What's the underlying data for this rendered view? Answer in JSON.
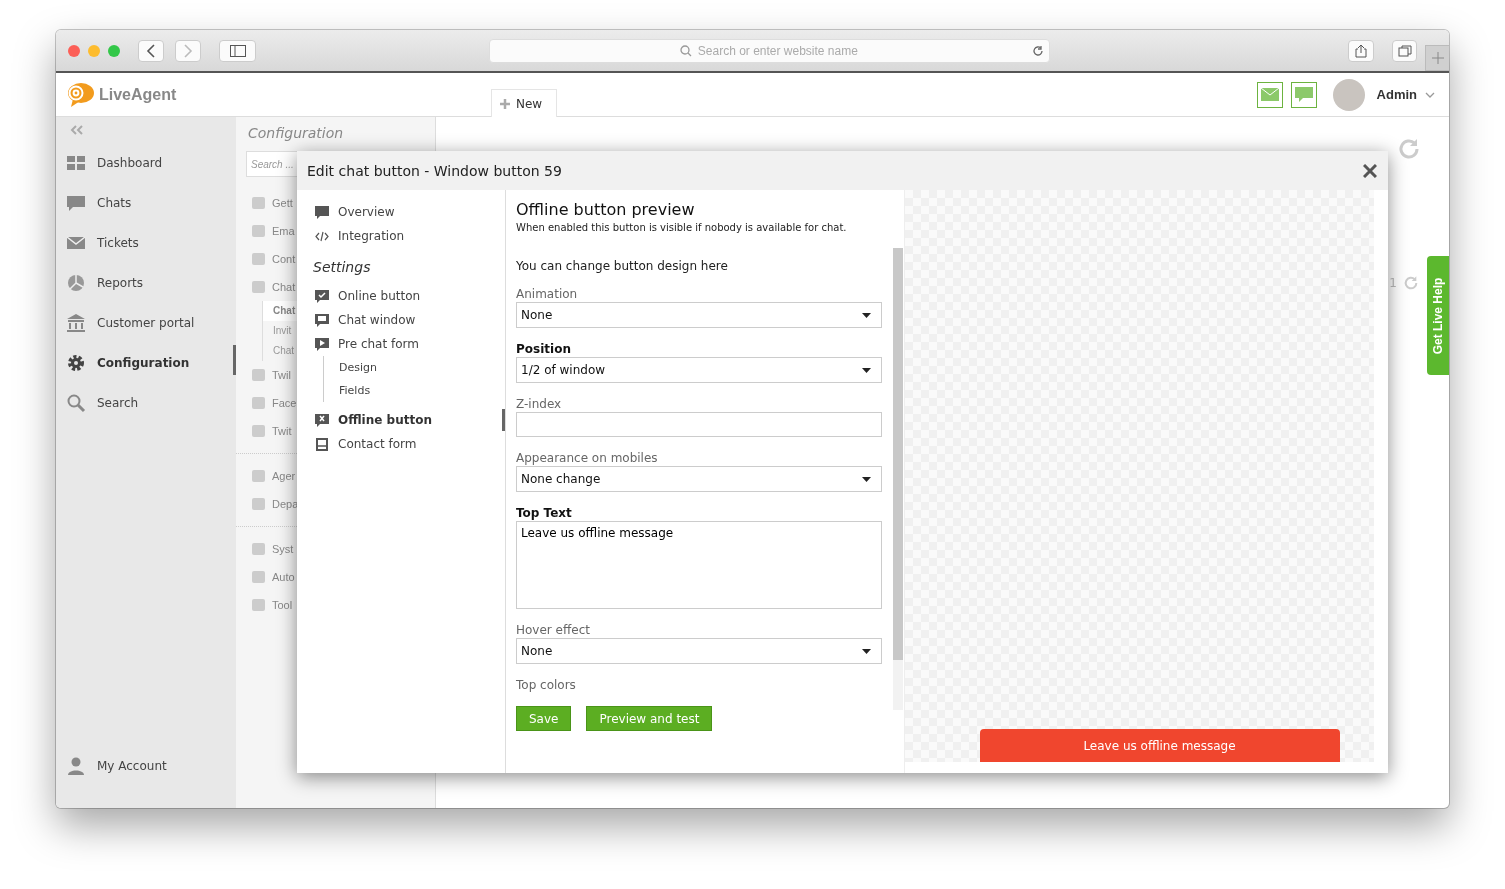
{
  "browser": {
    "address_placeholder": "Search or enter website name"
  },
  "header": {
    "logo": "LiveAgent",
    "new_button": "New",
    "user_name": "Admin"
  },
  "sidebar": {
    "items": [
      {
        "label": "Dashboard",
        "selected": false
      },
      {
        "label": "Chats",
        "selected": false
      },
      {
        "label": "Tickets",
        "selected": false
      },
      {
        "label": "Reports",
        "selected": false
      },
      {
        "label": "Customer portal",
        "selected": false
      },
      {
        "label": "Configuration",
        "selected": true
      },
      {
        "label": "Search",
        "selected": false
      }
    ],
    "account": "My Account"
  },
  "config_panel": {
    "title": "Configuration",
    "search_placeholder": "Search ...",
    "groups": [
      [
        {
          "label": "Gett",
          "kind": "item"
        },
        {
          "label": "Ema",
          "kind": "item"
        },
        {
          "label": "Cont",
          "kind": "item"
        },
        {
          "label": "Chat",
          "kind": "item"
        },
        {
          "label": "Chat",
          "kind": "sub",
          "selected": true
        },
        {
          "label": "Invit",
          "kind": "sub",
          "selected": false
        },
        {
          "label": "Chat",
          "kind": "sub",
          "selected": false
        },
        {
          "label": "Twil",
          "kind": "item"
        },
        {
          "label": "Face",
          "kind": "item"
        },
        {
          "label": "Twit",
          "kind": "item"
        }
      ],
      [
        {
          "label": "Ager",
          "kind": "item"
        },
        {
          "label": "Depa",
          "kind": "item"
        }
      ],
      [
        {
          "label": "Syst",
          "kind": "item"
        },
        {
          "label": "Auto",
          "kind": "item"
        },
        {
          "label": "Tool",
          "kind": "item"
        }
      ]
    ]
  },
  "page": {
    "pager": "1"
  },
  "help_tab": "Get Live Help",
  "modal": {
    "title": "Edit chat button - Window button 59",
    "nav": [
      {
        "label": "Overview",
        "kind": "link",
        "selected": false
      },
      {
        "label": "Integration",
        "kind": "link",
        "selected": false
      },
      {
        "label": "Settings",
        "kind": "heading"
      },
      {
        "label": "Online button",
        "kind": "link",
        "selected": false
      },
      {
        "label": "Chat window",
        "kind": "link",
        "selected": false
      },
      {
        "label": "Pre chat form",
        "kind": "link",
        "selected": false
      },
      {
        "label": "Design",
        "kind": "sub",
        "selected": false
      },
      {
        "label": "Fields",
        "kind": "sub",
        "selected": false
      },
      {
        "label": "Offline button",
        "kind": "link",
        "selected": true
      },
      {
        "label": "Contact form",
        "kind": "link",
        "selected": false
      }
    ],
    "form": {
      "title": "Offline button preview",
      "description": "When enabled this button is visible if nobody is available for chat.",
      "section": "You can change button design here",
      "fields": [
        {
          "label": "Animation",
          "kind": "select",
          "required": false,
          "value": "None"
        },
        {
          "label": "Position",
          "kind": "select",
          "required": true,
          "value": "1/2 of window"
        },
        {
          "label": "Z-index",
          "kind": "input",
          "required": false
        },
        {
          "label": "Appearance on mobiles",
          "kind": "select",
          "required": false,
          "value": "None change"
        },
        {
          "label": "Top Text",
          "kind": "textarea",
          "required": true,
          "value": "Leave us offline message"
        },
        {
          "label": "Hover effect",
          "kind": "select",
          "required": false,
          "value": "None"
        },
        {
          "label": "Top colors",
          "kind": "label",
          "required": false
        }
      ],
      "buttons": [
        "Save",
        "Preview and test"
      ]
    },
    "preview_button": "Leave us offline message"
  }
}
